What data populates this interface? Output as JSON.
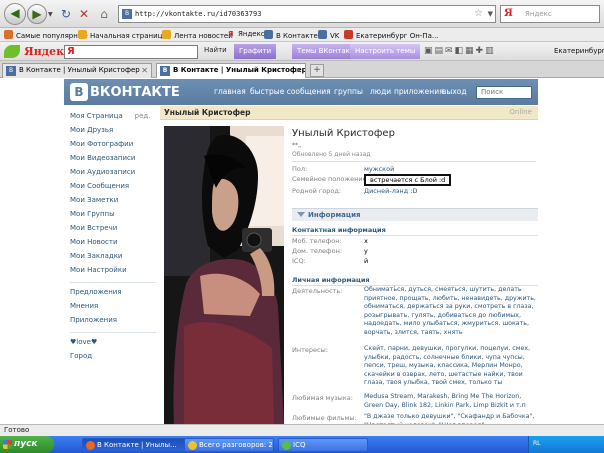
{
  "browser": {
    "url": "http://vkontakte.ru/id70363793",
    "search_placeholder": "Яндекс",
    "yandex_logo": "Я",
    "bookmarks": [
      {
        "label": "Самые популярные",
        "color": "#d8702a"
      },
      {
        "label": "Начальная страница",
        "color": "#e8a81f"
      },
      {
        "label": "Лента новостей",
        "color": "#e8a81f"
      },
      {
        "label": "Я",
        "color": "#ffffff"
      },
      {
        "label": "Яндекс",
        "color": "#ffffff"
      },
      {
        "label": "В Контакте",
        "color": "#4a6fa1"
      },
      {
        "label": "VK",
        "color": "#4a6fa1"
      },
      {
        "label": "Екатеринбург Он-Па...",
        "color": "#c93a2b"
      }
    ],
    "yandex_bar": {
      "logo": "Яндекс",
      "input_value": "Я",
      "go": "Найти",
      "buttons": [
        "Графити",
        "Темы ВКонтакте",
        "Настроить темы"
      ],
      "city": "Екатеринбург"
    },
    "tabs": [
      {
        "label": "В Контакте | Унылый Кристофер"
      },
      {
        "label": "В Контакте | Унылый Кристофер"
      }
    ],
    "new_tab": "+"
  },
  "vk": {
    "logo": "ВКОНТАКТЕ",
    "logo_badge": "В",
    "menu": [
      "главная",
      "быстрые сообщения",
      "группы",
      "люди",
      "приложения",
      "выход"
    ],
    "search_placeholder": "Поиск",
    "sidebar": [
      {
        "label": "Моя Страница",
        "edit": "ред."
      },
      {
        "label": "Мои Друзья"
      },
      {
        "label": "Мои Фотографии"
      },
      {
        "label": "Мои Видеозаписи"
      },
      {
        "label": "Мои Аудиозаписи"
      },
      {
        "label": "Мои Сообщения"
      },
      {
        "label": "Мои Заметки"
      },
      {
        "label": "Мои Группы"
      },
      {
        "label": "Мои Встречи"
      },
      {
        "label": "Мои Новости"
      },
      {
        "label": "Мои Закладки"
      },
      {
        "label": "Мои Настройки"
      }
    ],
    "sidebar_extra": [
      {
        "label": "Предложения"
      },
      {
        "label": "Мнения"
      },
      {
        "label": "Приложения"
      }
    ],
    "sidebar_extra2": [
      {
        "label": "♥love♥"
      },
      {
        "label": "Город"
      }
    ],
    "profile": {
      "name_bar": "Унылый Кристофер",
      "online": "Online",
      "name": "Унылый Кристофер",
      "status": "**,,",
      "updated": "Обновлено 5 дней назад",
      "fields": [
        {
          "key": "Пол:",
          "value": "мужской"
        },
        {
          "key": "Семейное положение:",
          "value": "встречается с Блой :d"
        },
        {
          "key": "Родной город:",
          "value": "Дисней-лэнд :D"
        }
      ],
      "info_title": "Информация",
      "contact_title": "Контактная информация",
      "contact": [
        {
          "key": "Моб. телефон:",
          "value": "х"
        },
        {
          "key": "Дом. телефон:",
          "value": "у"
        },
        {
          "key": "ICQ:",
          "value": "й"
        }
      ],
      "personal_title": "Личная информация",
      "activity_key": "Деятельность:",
      "activity": "Обнимать́ся, дуться, смеяться, шутить, делать приятное, прощать, любить, ненавидеть, дружить, обниматься, держаться за руки, смотреть в глаза, розыгрывать, гулять, добиваться до любимых, надоедать, мило улыбаться, жмуриться, шокать, ворчать, злится, таять, хнять",
      "interests_key": "Интересы:",
      "interests": "Скейт, парни, девушки, прогулки, поцелуи, смех, улыбки, радость, солнечные блики, чупа чупсы, пепси, треш, музыка, классика, Мерлин Монро, скачейки в озврах, лето, шетастые найки, твои глаза, твоя улыбка, твой смех, только ты",
      "music_key": "Любимая музыка:",
      "music": "Medusa Stream, Marakesh, Bring Me The Horizon, Green Day, Blink 182, Linkin Park, Limp Bizkit и т.п",
      "films_key": "Любимые фильмы:",
      "films": "\"В джазе только девушки\", \"Скафандр и Бабочка\", \"Цветастый человек\", \"Шаг вперед\""
    }
  },
  "status_bar": "Готово",
  "taskbar": {
    "start": "пуск",
    "items": [
      {
        "label": "В Контакте | Унылы...",
        "color": "#e86a1f"
      },
      {
        "label": "Всего разговоров: 2...",
        "color": "#f1c12c"
      },
      {
        "label": "ICQ",
        "color": "#54c04a"
      }
    ],
    "lang": "RL"
  }
}
